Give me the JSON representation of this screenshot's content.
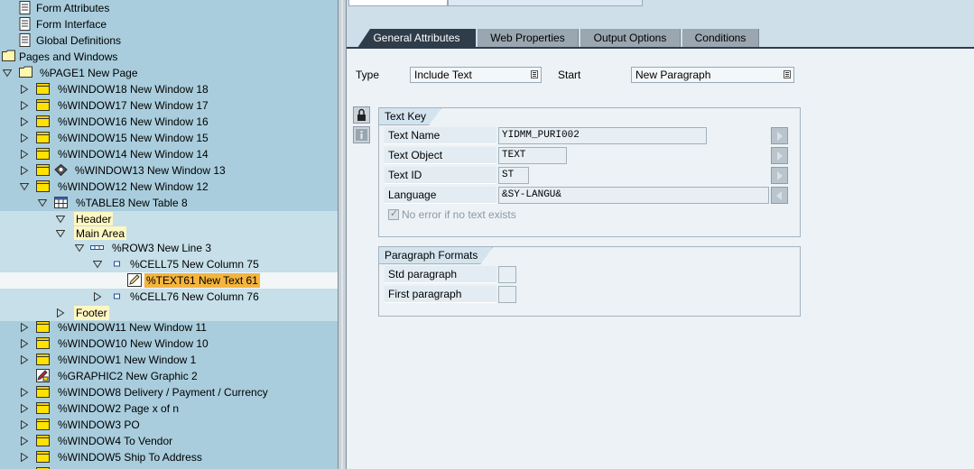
{
  "tree": {
    "items": [
      {
        "label": "Form Attributes",
        "icon": "document-icon"
      },
      {
        "label": "Form Interface",
        "icon": "document-icon"
      },
      {
        "label": "Global Definitions",
        "icon": "document-icon"
      },
      {
        "label": "Pages and Windows",
        "icon": "folder-icon"
      },
      {
        "label": "%PAGE1 New Page",
        "icon": "folder-icon"
      },
      {
        "label": "%WINDOW18 New Window 18",
        "icon": "window-icon"
      },
      {
        "label": "%WINDOW17 New Window 17",
        "icon": "window-icon"
      },
      {
        "label": "%WINDOW16 New Window 16",
        "icon": "window-icon"
      },
      {
        "label": "%WINDOW15 New Window 15",
        "icon": "window-icon"
      },
      {
        "label": "%WINDOW14 New Window 14",
        "icon": "window-icon"
      },
      {
        "label": "%WINDOW13 New Window 13",
        "icon": "window-icon"
      },
      {
        "label": "%WINDOW12 New Window 12",
        "icon": "window-icon"
      },
      {
        "label": "%TABLE8 New Table 8",
        "icon": "table-icon"
      },
      {
        "label": "Header",
        "icon": ""
      },
      {
        "label": "Main Area",
        "icon": ""
      },
      {
        "label": "%ROW3 New Line 3",
        "icon": "row-icon"
      },
      {
        "label": "%CELL75 New Column 75",
        "icon": "cell-icon"
      },
      {
        "label": "%TEXT61 New Text 61",
        "icon": "text-icon"
      },
      {
        "label": "%CELL76 New Column 76",
        "icon": "cell-icon"
      },
      {
        "label": "Footer",
        "icon": ""
      },
      {
        "label": "%WINDOW11 New Window 11",
        "icon": "window-icon"
      },
      {
        "label": "%WINDOW10 New Window 10",
        "icon": "window-icon"
      },
      {
        "label": "%WINDOW1 New Window 1",
        "icon": "window-icon"
      },
      {
        "label": "%GRAPHIC2 New Graphic 2",
        "icon": "graphic-icon"
      },
      {
        "label": "%WINDOW8 Delivery / Payment / Currency",
        "icon": "window-icon"
      },
      {
        "label": "%WINDOW2 Page x of n",
        "icon": "window-icon"
      },
      {
        "label": "%WINDOW3 PO",
        "icon": "window-icon"
      },
      {
        "label": "%WINDOW4 To Vendor",
        "icon": "window-icon"
      },
      {
        "label": "%WINDOW5 Ship To Address",
        "icon": "window-icon"
      }
    ]
  },
  "tabs": [
    {
      "label": "General Attributes"
    },
    {
      "label": "Web Properties"
    },
    {
      "label": "Output Options"
    },
    {
      "label": "Conditions"
    }
  ],
  "general": {
    "type_label": "Type",
    "type_value": "Include Text",
    "start_label": "Start",
    "start_value": "New Paragraph"
  },
  "text_key": {
    "title": "Text Key",
    "text_name_label": "Text Name",
    "text_name_value": "YIDMM_PURI002",
    "text_object_label": "Text Object",
    "text_object_value": "TEXT",
    "text_id_label": "Text ID",
    "text_id_value": "ST",
    "language_label": "Language",
    "language_value": "&SY-LANGU&",
    "no_error_label": "No error if no text exists",
    "no_error_checked": true
  },
  "paragraph_formats": {
    "title": "Paragraph Formats",
    "std_label": "Std paragraph",
    "std_value": "",
    "first_label": "First paragraph",
    "first_value": ""
  },
  "colors": {
    "tree_bg": "#a9cddd",
    "selected": "#f4b43e",
    "highlight": "#fff7c2",
    "active_tab": "#2f3c4a"
  }
}
